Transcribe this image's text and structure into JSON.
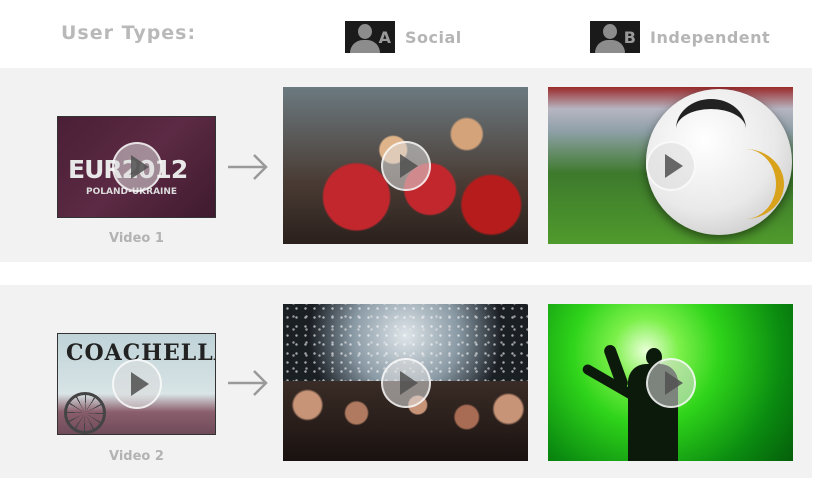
{
  "header": {
    "title": "User Types:"
  },
  "user_types": [
    {
      "letter": "A",
      "label": "Social",
      "icon": "user-silhouette-icon"
    },
    {
      "letter": "B",
      "label": "Independent",
      "icon": "user-silhouette-icon"
    }
  ],
  "rows": [
    {
      "video_label": "Video 1",
      "source": {
        "icon": "play-icon",
        "text": "EUR",
        "year": "2012",
        "subtitle": "POLAND-UKRAINE"
      },
      "social_icon": "play-icon",
      "independent_icon": "play-icon"
    },
    {
      "video_label": "Video 2",
      "source": {
        "icon": "play-icon",
        "text": "COACHELLA"
      },
      "social_icon": "play-icon",
      "independent_icon": "play-icon"
    }
  ],
  "colors": {
    "row_background": "#f2f2f2",
    "label_gray": "#b5b5b5",
    "badge_dark": "#1a1a1a"
  }
}
